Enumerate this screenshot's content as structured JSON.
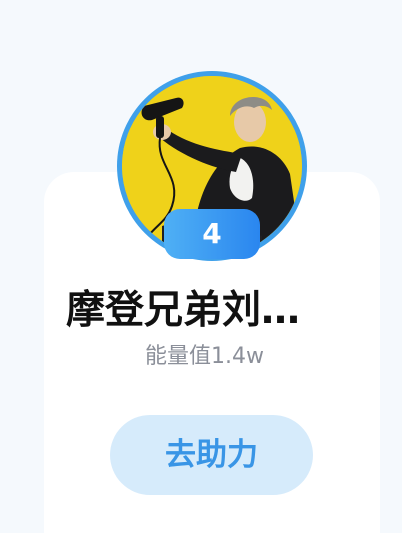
{
  "profile": {
    "avatar_icon": "user-photo",
    "rank": "4",
    "name": "摩登兄弟刘…",
    "energy": "能量值1.4w"
  },
  "actions": {
    "help_label": "去助力"
  },
  "colors": {
    "avatar_ring": "#3fa0ea",
    "badge_start": "#4fb0f5",
    "badge_end": "#2a86ef",
    "button_bg": "#d6ebfb",
    "button_text": "#3995e6",
    "avatar_bg": "#efd21a"
  }
}
